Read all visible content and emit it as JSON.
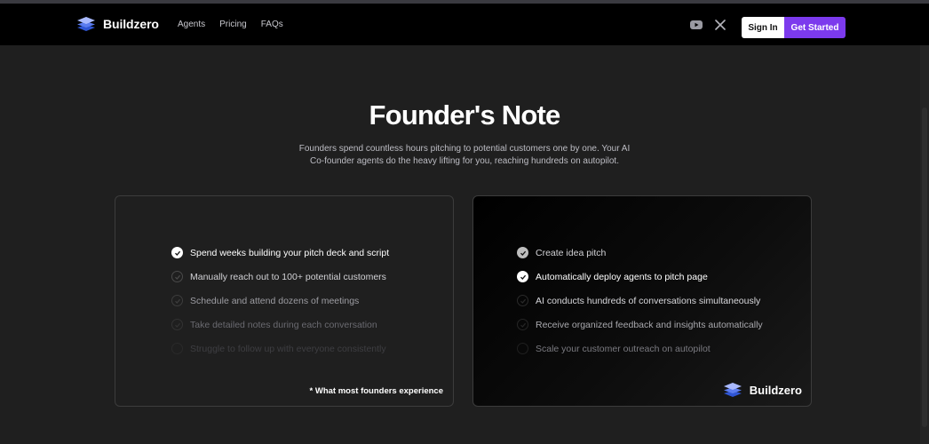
{
  "nav": {
    "brand": "Buildzero",
    "links": [
      "Agents",
      "Pricing",
      "FAQs"
    ],
    "icons": [
      "youtube-icon",
      "x-icon"
    ],
    "sign_in": "Sign In",
    "get_started": "Get Started"
  },
  "hero": {
    "title": "Founder's Note",
    "subtitle_line1": "Founders spend countless hours pitching to potential customers one by one. Your AI",
    "subtitle_line2": "Co-founder agents do the heavy lifting for you, reaching hundreds on autopilot."
  },
  "left_card": {
    "items": [
      "Spend weeks building your pitch deck and script",
      "Manually reach out to 100+ potential customers",
      "Schedule and attend dozens of meetings",
      "Take detailed notes during each conversation",
      "Struggle to follow up with everyone consistently"
    ],
    "footnote": "* What most founders experience"
  },
  "right_card": {
    "items": [
      "Create idea pitch",
      "Automatically deploy agents to pitch page",
      "AI conducts hundreds of conversations simultaneously",
      "Receive organized feedback and insights automatically",
      "Scale your customer outreach on autopilot"
    ],
    "brand": "Buildzero"
  },
  "colors": {
    "accent": "#7c3aed",
    "background": "#1f1f1f",
    "nav_background": "#000000"
  }
}
